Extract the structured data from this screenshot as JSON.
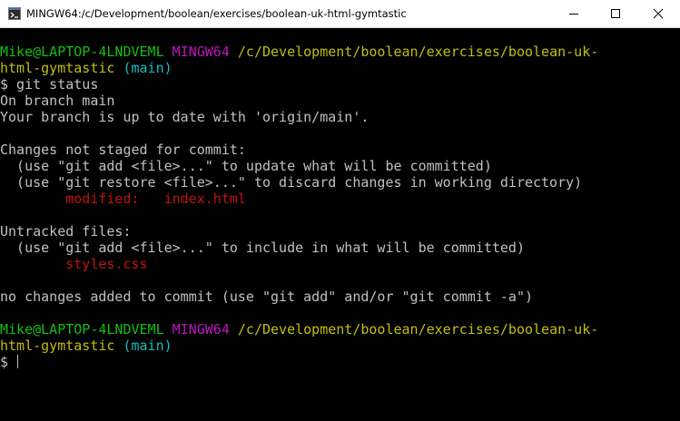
{
  "window": {
    "title": "MINGW64:/c/Development/boolean/exercises/boolean-uk-html-gymtastic",
    "app_icon": "mingw-terminal-icon",
    "buttons": {
      "minimize_icon": "minimize-icon",
      "maximize_icon": "maximize-icon",
      "close_icon": "close-icon"
    }
  },
  "colors": {
    "background": "#000000",
    "text": "#c0c0c0",
    "user_host": "#13bf13",
    "msystem": "#bf13bf",
    "path": "#bfbf13",
    "branch": "#13bfbf",
    "modified": "#bf1313"
  },
  "terminal": {
    "prompt1": {
      "user_host": "Mike@LAPTOP-4LNDVEML",
      "msystem": "MINGW64",
      "path_line1": "/c/Development/boolean/exercises/boolean-uk-",
      "path_line2": "html-gymtastic",
      "branch": "(main)"
    },
    "command": "$ git status",
    "output": {
      "on_branch": "On branch main",
      "up_to_date": "Your branch is up to date with 'origin/main'.",
      "changes_header": "Changes not staged for commit:",
      "hint_add": "  (use \"git add <file>...\" to update what will be committed)",
      "hint_restore": "  (use \"git restore <file>...\" to discard changes in working directory)",
      "modified_label": "        modified:   ",
      "modified_file": "index.html",
      "untracked_header": "Untracked files:",
      "hint_include": "  (use \"git add <file>...\" to include in what will be committed)",
      "untracked_file": "        styles.css",
      "no_changes": "no changes added to commit (use \"git add\" and/or \"git commit -a\")"
    },
    "prompt2": {
      "user_host": "Mike@LAPTOP-4LNDVEML",
      "msystem": "MINGW64",
      "path_line1": "/c/Development/boolean/exercises/boolean-uk-",
      "path_line2": "html-gymtastic",
      "branch": "(main)"
    },
    "current_prompt": "$ "
  }
}
